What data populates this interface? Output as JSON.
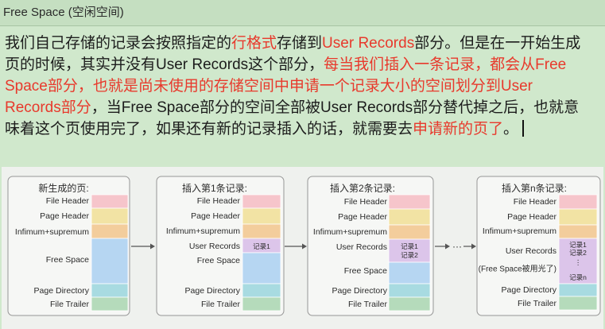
{
  "header": {
    "title": "Free Space (空闲空间)"
  },
  "paragraph": {
    "lines": [
      [
        {
          "text": "我们自己存储的记录会按照指定的",
          "highlight": false
        },
        {
          "text": "行格式",
          "highlight": true
        },
        {
          "text": "存储到",
          "highlight": false
        },
        {
          "text": "User Records",
          "highlight": true
        },
        {
          "text": "部分。但是在一开始生成",
          "highlight": false
        }
      ],
      [
        {
          "text": "页的时候，其实并没有User Records这个部分，",
          "highlight": false
        },
        {
          "text": "每当我们插入一条记录，都会从Free",
          "highlight": true
        }
      ],
      [
        {
          "text": "Space部分，也就是尚未使用的存储空间中申请一个记录大小的空间划分到User",
          "highlight": true
        }
      ],
      [
        {
          "text": "Records部分",
          "highlight": true
        },
        {
          "text": "，当Free Space部分的空间全部被User Records部分替代掉之后，也就意",
          "highlight": false
        }
      ],
      [
        {
          "text": "味着这个页使用完了，如果还有新的记录插入的话，就需要去",
          "highlight": false
        },
        {
          "text": "申请新的页了",
          "highlight": true
        },
        {
          "text": "。",
          "highlight": false
        }
      ]
    ]
  },
  "colors": {
    "page_background": "#d0e8cc",
    "header_background": "#c5dfc1",
    "highlight_text": "#e8392c",
    "diagram_background": "#eff1ee",
    "box_fill": "#f6f7f5",
    "box_stroke": "#969696",
    "arrow": "#555555"
  },
  "diagram": {
    "pages": [
      {
        "title": "新生成的页:",
        "rows": [
          {
            "label": "File Header",
            "fill": "#f6c5cb"
          },
          {
            "label": "Page Header",
            "fill": "#f2e3a4"
          },
          {
            "label": "Infimum+supremum",
            "fill": "#f3cd9c"
          },
          {
            "label": "Free Space",
            "fill": "#b6d6f2"
          },
          {
            "label": "Page Directory",
            "fill": "#a8dbe1"
          },
          {
            "label": "File Trailer",
            "fill": "#b5dbbb"
          }
        ]
      },
      {
        "title": "插入第1条记录:",
        "rows": [
          {
            "label": "File Header",
            "fill": "#f6c5cb"
          },
          {
            "label": "Page Header",
            "fill": "#f2e3a4"
          },
          {
            "label": "Infimum+supremum",
            "fill": "#f3cd9c"
          },
          {
            "label": "User Records",
            "fill": "#dcc5ea",
            "records": [
              "记录1"
            ]
          },
          {
            "label": "Free Space",
            "fill": "#b6d6f2"
          },
          {
            "label": "Page Directory",
            "fill": "#a8dbe1"
          },
          {
            "label": "File Trailer",
            "fill": "#b5dbbb"
          }
        ]
      },
      {
        "title": "插入第2条记录:",
        "rows": [
          {
            "label": "File Header",
            "fill": "#f6c5cb"
          },
          {
            "label": "Page Header",
            "fill": "#f2e3a4"
          },
          {
            "label": "Infimum+supremum",
            "fill": "#f3cd9c"
          },
          {
            "label": "User Records",
            "fill": "#dcc5ea",
            "records": [
              "记录1",
              "记录2"
            ]
          },
          {
            "label": "Free Space",
            "fill": "#b6d6f2"
          },
          {
            "label": "Page Directory",
            "fill": "#a8dbe1"
          },
          {
            "label": "File Trailer",
            "fill": "#b5dbbb"
          }
        ]
      },
      {
        "title": "插入第n条记录:",
        "rows": [
          {
            "label": "File Header",
            "fill": "#f6c5cb"
          },
          {
            "label": "Page Header",
            "fill": "#f2e3a4"
          },
          {
            "label": "Infimum+supremum",
            "fill": "#f3cd9c"
          },
          {
            "label": "User Records",
            "fill": "#dcc5ea",
            "records": [
              "记录1",
              "记录2",
              "⋮",
              "记录n"
            ]
          },
          {
            "label": "(Free Space被用光了)",
            "fill": null
          },
          {
            "label": "Page Directory",
            "fill": "#a8dbe1"
          },
          {
            "label": "File Trailer",
            "fill": "#b5dbbb"
          }
        ]
      }
    ],
    "ellipsis": "···"
  }
}
